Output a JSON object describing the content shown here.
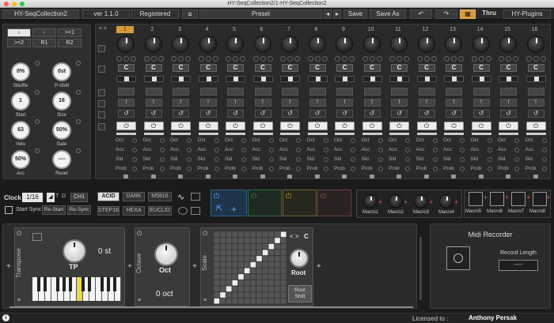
{
  "window": {
    "title": "HY-SeqCollection2/1-HY-SeqCollection2"
  },
  "topbar": {
    "plugin_name": "HY-SeqCollection2",
    "version": "ver 1.1.0",
    "registered": "Registered",
    "menu_icon": "hamburger-icon",
    "preset_label": "Preset",
    "save": "Save",
    "save_as": "Save As",
    "undo_icon": "undo-icon",
    "redo_icon": "redo-icon",
    "thru": "Thru",
    "brand": "HY-Plugins"
  },
  "left_panel": {
    "nav_buttons": [
      "›",
      "‹",
      "><1",
      "><2",
      "R1",
      "R2"
    ],
    "knobs": [
      {
        "value": "0%",
        "label": "Shuffle"
      },
      {
        "value": "0st",
        "label": "P-Shift"
      },
      {
        "value": "1",
        "label": "Start"
      },
      {
        "value": "16",
        "label": "Size"
      },
      {
        "value": "63",
        "label": "Velo"
      },
      {
        "value": "50%",
        "label": "Gate"
      },
      {
        "value": "50%",
        "label": "Acc"
      },
      {
        "value": "----",
        "label": "Reset"
      }
    ]
  },
  "sequencer": {
    "nav": "< >",
    "steps": [
      "1",
      "2",
      "3",
      "4",
      "5",
      "6",
      "7",
      "8",
      "9",
      "10",
      "11",
      "12",
      "13",
      "14",
      "15",
      "16"
    ],
    "active_step": 1,
    "note_letter": "C",
    "excl_mark": "!",
    "power_glyph": "⏻",
    "labels": {
      "oct": "Oct",
      "acc": "Acc",
      "sld": "Sld",
      "prob": "Prob"
    }
  },
  "clock": {
    "label": "Clock",
    "division": "1/16",
    "t": "T",
    "d": "D",
    "channel": "CH1",
    "start_sync": "Start Sync",
    "re_start": "Re-Start",
    "re_sync": "Re-Sync"
  },
  "modes": {
    "row1": [
      "ACID",
      "DARK",
      "M5816"
    ],
    "row2": [
      "STEP16",
      "HEXA",
      "EUCLID"
    ],
    "selected": "ACID"
  },
  "macros": {
    "knob_labels": [
      "Macro1",
      "Macro2",
      "Macro3",
      "Macro4"
    ],
    "slot_labels": [
      "Macro5",
      "Macro6",
      "Macro7",
      "Macro8"
    ]
  },
  "chain": {
    "transpose": {
      "title": "Transpose",
      "knob_label": "TP",
      "value": "0 st"
    },
    "octave": {
      "title": "Octave",
      "knob_label": "Oct",
      "value": "0 oct"
    },
    "scale": {
      "title": "Scale",
      "note": "C",
      "knob_label": "Root",
      "shift_label": "Root Shift"
    }
  },
  "recorder": {
    "title": "Midi Recorder",
    "record_length_label": "Record Length",
    "record_length_value": "-----"
  },
  "status": {
    "licensed_to_label": "Licensed to :",
    "licensee": "Anthony Persak",
    "info_icon": "info-icon"
  },
  "colors": {
    "accent": "#d69a3a",
    "slot1": "#2f5f88",
    "slot2": "#2f6a45",
    "slot3": "#6a6530",
    "slot4": "#6a3f45",
    "highlight_key": "#e8d84a"
  }
}
